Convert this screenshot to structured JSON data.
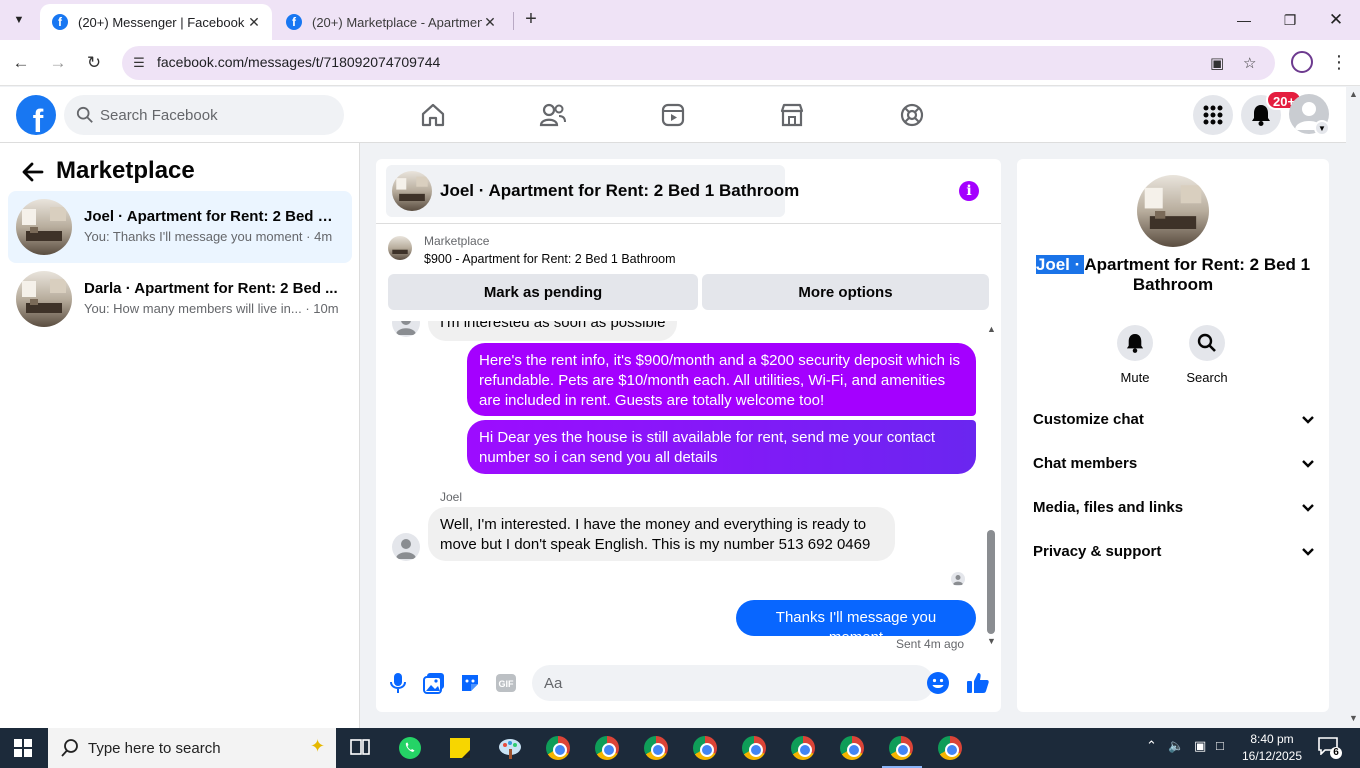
{
  "browser": {
    "tabs": [
      {
        "title": "(20+) Messenger | Facebook",
        "active": true
      },
      {
        "title": "(20+) Marketplace - Apartment",
        "active": false
      }
    ],
    "url": "facebook.com/messages/t/718092074709744"
  },
  "fb_header": {
    "search_placeholder": "Search Facebook",
    "notification_badge": "20+"
  },
  "sidebar": {
    "title": "Marketplace",
    "conversations": [
      {
        "title": "Joel · Apartment for Rent: 2 Bed 1 ...",
        "preview": "You: Thanks I'll message you moment · 4m",
        "selected": true
      },
      {
        "title": "Darla · Apartment for Rent: 2 Bed ...",
        "preview": "You: How many members will live in... · 10m",
        "selected": false
      }
    ]
  },
  "chat": {
    "title": "Joel · Apartment for Rent: 2 Bed 1 Bathroom",
    "listing_label": "Marketplace",
    "listing_price": "$900 - Apartment for Rent: 2 Bed 1 Bathroom",
    "mark_pending": "Mark as pending",
    "more_options": "More options",
    "messages": {
      "partial_in": "I'm interested as soon as possible",
      "out_1": "Here's the rent info, it's $900/month and a $200 security deposit which is refundable. Pets are $10/month each. All utilities, Wi-Fi, and amenities are included in rent. Guests are totally welcome too!",
      "out_2": "Hi Dear yes the house is still available for rent, send me your contact number so i can send you all details",
      "sender_name": "Joel",
      "in_1": "Well, I'm interested. I have the money and everything is ready to move but I don't speak English. This is my number 513 692 0469",
      "out_3": "Thanks I'll message you moment",
      "sent_status": "Sent 4m ago"
    },
    "composer_placeholder": "Aa"
  },
  "details": {
    "title_highlight": "Joel · ",
    "title_rest": "Apartment for Rent: 2 Bed 1 Bathroom",
    "actions": [
      {
        "label": "Mute",
        "icon": "bell-icon"
      },
      {
        "label": "Search",
        "icon": "search-icon"
      }
    ],
    "sections": [
      "Customize chat",
      "Chat members",
      "Media, files and links",
      "Privacy & support"
    ]
  },
  "taskbar": {
    "search_placeholder": "Type here to search",
    "time": "8:40 pm",
    "date": "16/12/2025",
    "notification_count": "6"
  },
  "colors": {
    "fb_blue": "#1877f2",
    "bubble_purple": "#a400ff",
    "bubble_blue": "#0866ff"
  }
}
